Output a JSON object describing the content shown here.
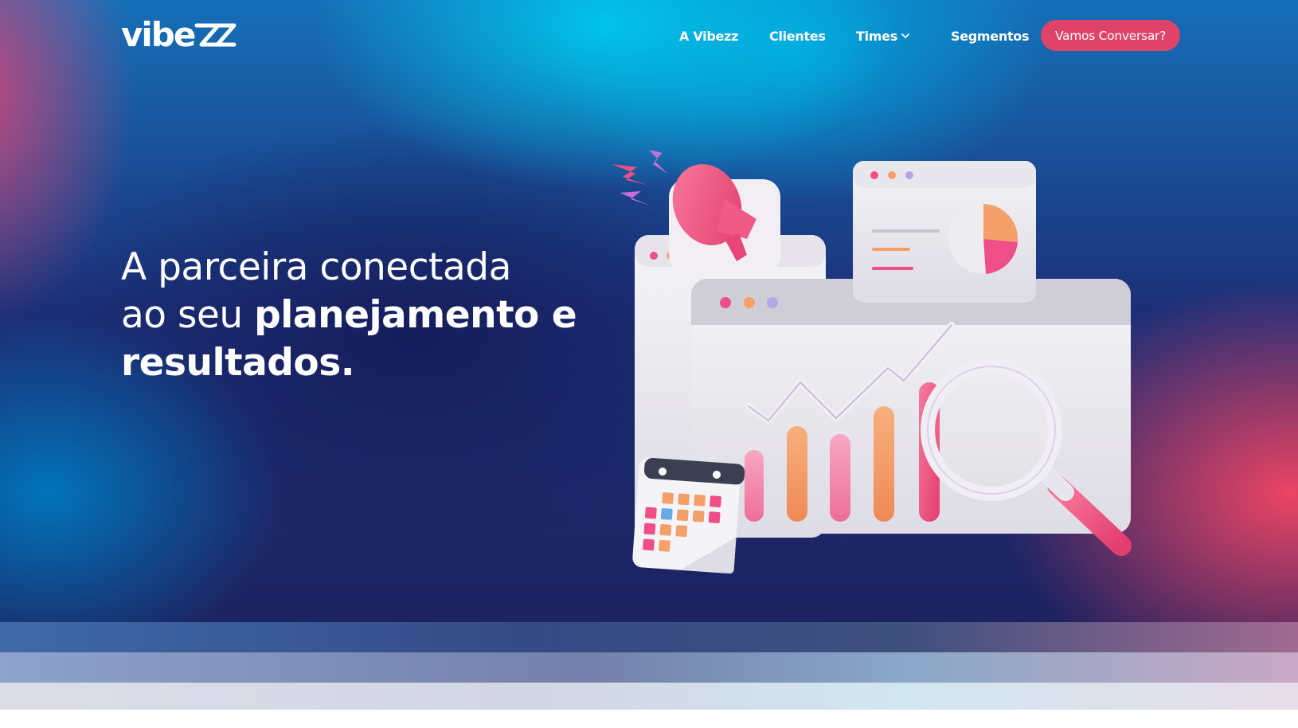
{
  "brand": {
    "logo_text": "Vibezz"
  },
  "nav": {
    "items": [
      {
        "label": "A Vibezz"
      },
      {
        "label": "Clientes"
      },
      {
        "label": "Times",
        "has_dropdown": true
      },
      {
        "label": "Segmentos"
      }
    ],
    "cta_label": "Vamos Conversar?"
  },
  "hero": {
    "headline_part1": "A parceira conectada",
    "headline_part2": "ao seu ",
    "headline_bold1": "planejamento e",
    "headline_bold2": "resultados."
  },
  "colors": {
    "cta_background": "#e0436a",
    "text": "#ffffff",
    "accent_pink": "#ef4f86",
    "accent_orange": "#f5a06a",
    "accent_lilac": "#b7a6e6"
  },
  "illustration": {
    "icons": [
      "megaphone-icon",
      "lightning-icon",
      "browser-window-icon",
      "pie-chart-icon",
      "bar-chart-icon",
      "trend-line-icon",
      "magnifier-icon",
      "calendar-icon"
    ]
  }
}
